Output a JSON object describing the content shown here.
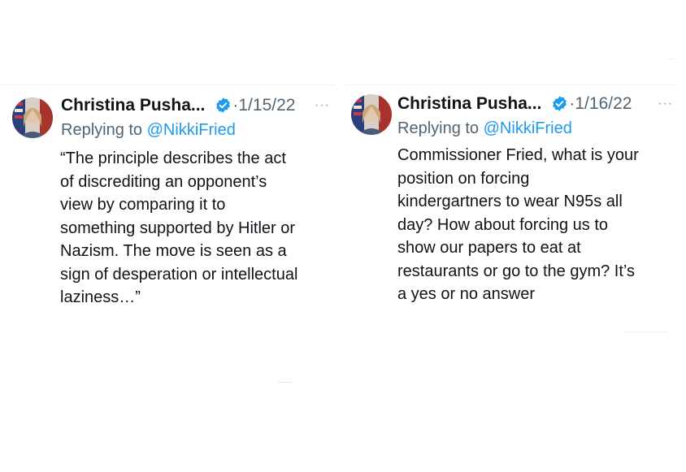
{
  "tweets": [
    {
      "author": "Christina Pusha...",
      "separator": "·",
      "date": "1/15/22",
      "more": "···",
      "reply_prefix": "Replying to ",
      "reply_handle": "@NikkiFried",
      "lines": [
        "“The principle describes the act",
        "of discrediting an opponent’s",
        "view by comparing it to",
        "something supported by Hitler or",
        "Nazism. The move is seen as a",
        "sign of desperation or intellectual",
        "laziness…”"
      ]
    },
    {
      "author": "Christina Pusha...",
      "separator": "·",
      "date": "1/16/22",
      "more": "···",
      "reply_prefix": "Replying to ",
      "reply_handle": "@NikkiFried",
      "lines": [
        "Commissioner Fried, what is your",
        "position on forcing",
        "kindergartners to wear N95s all",
        "day? How about forcing us to",
        "show our papers to eat at",
        "restaurants or go to the gym? It’s",
        "a yes or no answer"
      ]
    }
  ],
  "colors": {
    "text": "#0f1419",
    "muted": "#536471",
    "link": "#1d9bf0",
    "verified_badge": "#1d9bf0",
    "rule": "#eff3f4"
  },
  "icons": {
    "verified": "verified-badge-icon",
    "more": "more-options-icon"
  }
}
